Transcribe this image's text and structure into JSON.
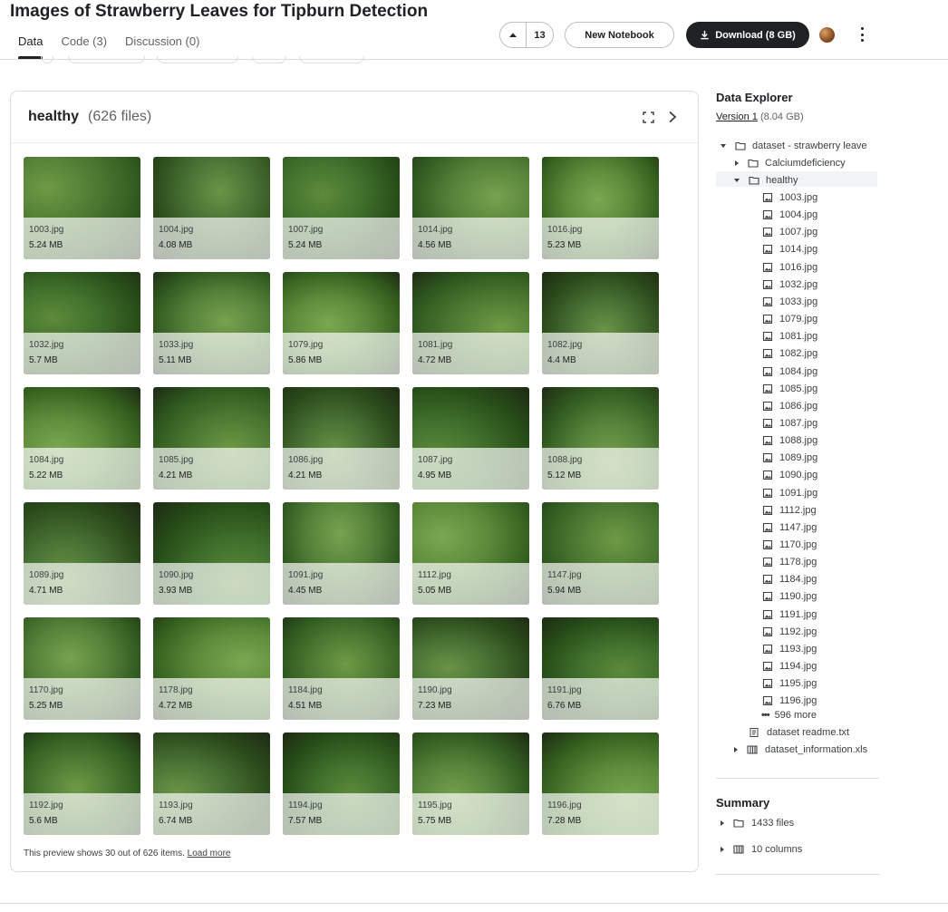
{
  "header": {
    "title": "Images of Strawberry Leaves for Tipburn Detection",
    "tabs": [
      {
        "label": "Data"
      },
      {
        "label": "Code (3)"
      },
      {
        "label": "Discussion (0)"
      }
    ],
    "vote_count": "13",
    "new_notebook_label": "New Notebook",
    "download_label": "Download (8 GB)"
  },
  "panel": {
    "folder": "healthy",
    "file_count": "(626 files)",
    "preview_note": "This preview shows 30 out of 626 items.",
    "load_more": "Load more",
    "files": [
      {
        "name": "1003.jpg",
        "size": "5.24 MB"
      },
      {
        "name": "1004.jpg",
        "size": "4.08 MB"
      },
      {
        "name": "1007.jpg",
        "size": "5.24 MB"
      },
      {
        "name": "1014.jpg",
        "size": "4.56 MB"
      },
      {
        "name": "1016.jpg",
        "size": "5.23 MB"
      },
      {
        "name": "1032.jpg",
        "size": "5.7 MB"
      },
      {
        "name": "1033.jpg",
        "size": "5.11 MB"
      },
      {
        "name": "1079.jpg",
        "size": "5.86 MB"
      },
      {
        "name": "1081.jpg",
        "size": "4.72 MB"
      },
      {
        "name": "1082.jpg",
        "size": "4.4 MB"
      },
      {
        "name": "1084.jpg",
        "size": "5.22 MB"
      },
      {
        "name": "1085.jpg",
        "size": "4.21 MB"
      },
      {
        "name": "1086.jpg",
        "size": "4.21 MB"
      },
      {
        "name": "1087.jpg",
        "size": "4.95 MB"
      },
      {
        "name": "1088.jpg",
        "size": "5.12 MB"
      },
      {
        "name": "1089.jpg",
        "size": "4.71 MB"
      },
      {
        "name": "1090.jpg",
        "size": "3.93 MB"
      },
      {
        "name": "1091.jpg",
        "size": "4.45 MB"
      },
      {
        "name": "1112.jpg",
        "size": "5.05 MB"
      },
      {
        "name": "1147.jpg",
        "size": "5.94 MB"
      },
      {
        "name": "1170.jpg",
        "size": "5.25 MB"
      },
      {
        "name": "1178.jpg",
        "size": "4.72 MB"
      },
      {
        "name": "1184.jpg",
        "size": "4.51 MB"
      },
      {
        "name": "1190.jpg",
        "size": "7.23 MB"
      },
      {
        "name": "1191.jpg",
        "size": "6.76 MB"
      },
      {
        "name": "1192.jpg",
        "size": "5.6 MB"
      },
      {
        "name": "1193.jpg",
        "size": "6.74 MB"
      },
      {
        "name": "1194.jpg",
        "size": "7.57 MB"
      },
      {
        "name": "1195.jpg",
        "size": "5.75 MB"
      },
      {
        "name": "1196.jpg",
        "size": "7.28 MB"
      }
    ]
  },
  "sidebar": {
    "title": "Data Explorer",
    "version_link": "Version 1",
    "version_size": "(8.04 GB)",
    "root": "dataset - strawberry leave",
    "folders": [
      "Calciumdeficiency",
      "healthy"
    ],
    "healthy_files": [
      "1003.jpg",
      "1004.jpg",
      "1007.jpg",
      "1014.jpg",
      "1016.jpg",
      "1032.jpg",
      "1033.jpg",
      "1079.jpg",
      "1081.jpg",
      "1082.jpg",
      "1084.jpg",
      "1085.jpg",
      "1086.jpg",
      "1087.jpg",
      "1088.jpg",
      "1089.jpg",
      "1090.jpg",
      "1091.jpg",
      "1112.jpg",
      "1147.jpg",
      "1170.jpg",
      "1178.jpg",
      "1184.jpg",
      "1190.jpg",
      "1191.jpg",
      "1192.jpg",
      "1193.jpg",
      "1194.jpg",
      "1195.jpg",
      "1196.jpg"
    ],
    "more": "596 more",
    "readme": "dataset readme.txt",
    "info_file": "dataset_information.xls",
    "summary_title": "Summary",
    "summary_files": "1433 files",
    "summary_columns": "10 columns"
  }
}
